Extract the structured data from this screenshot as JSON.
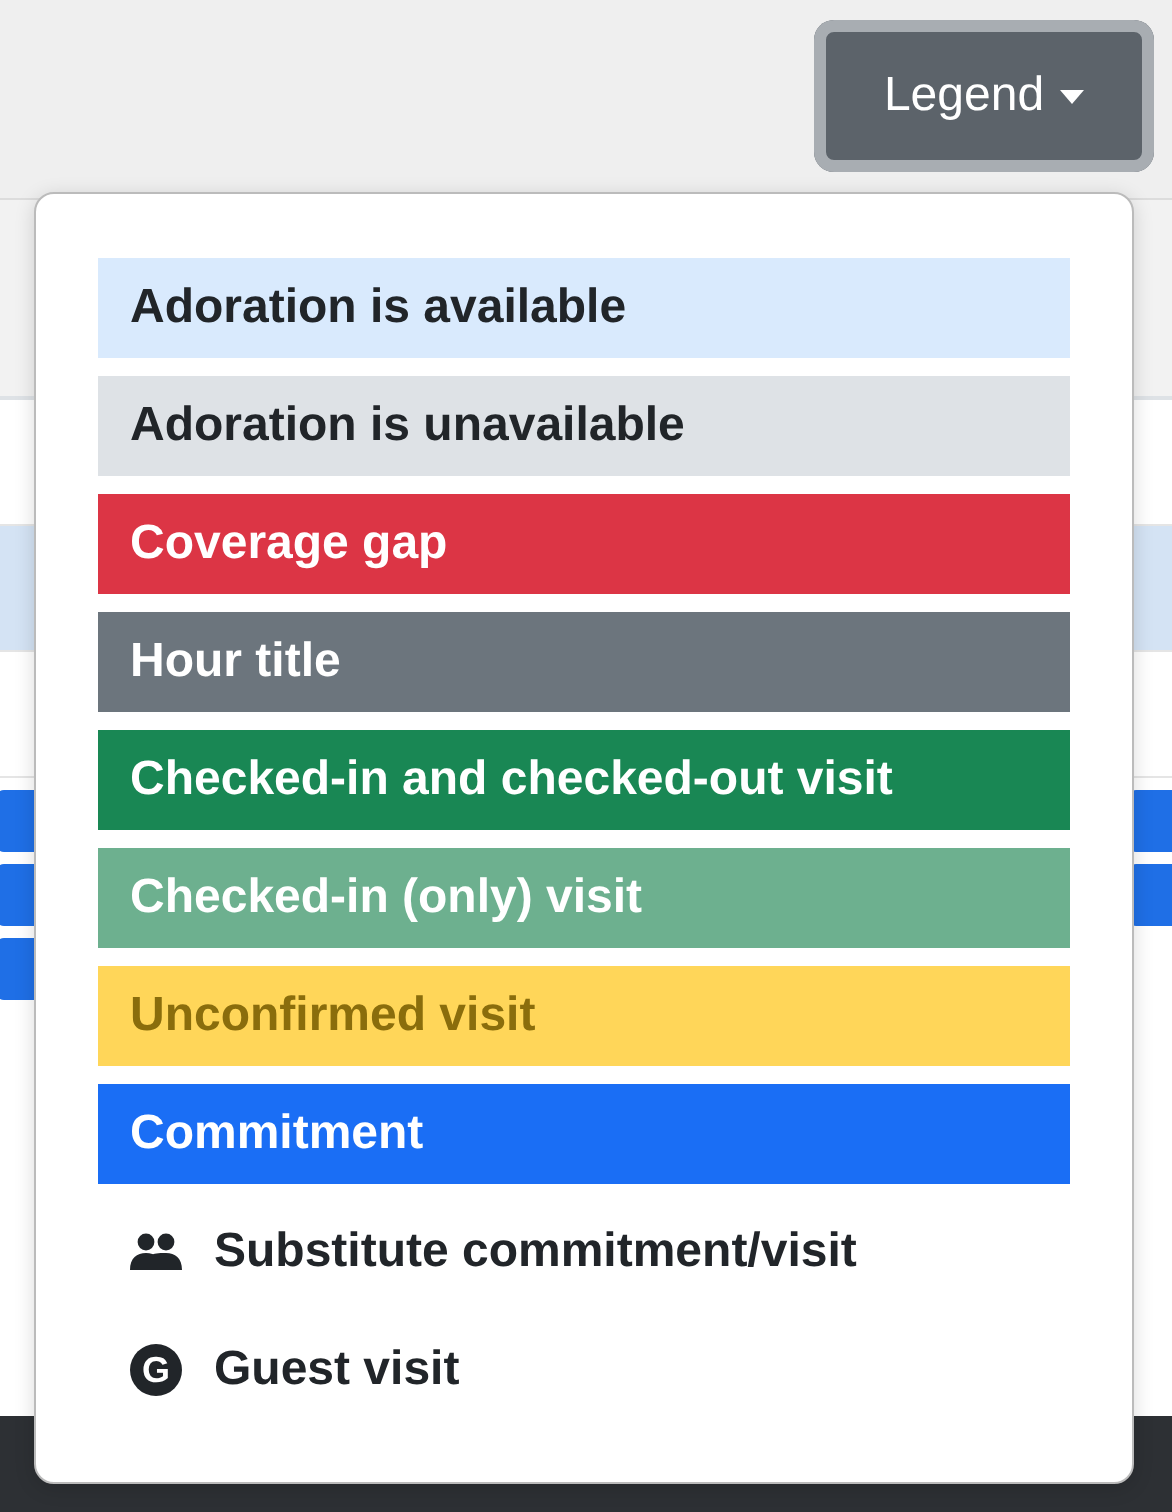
{
  "legend_button": {
    "label": "Legend",
    "expanded": true
  },
  "legend": [
    {
      "kind": "swatch",
      "label": "Adoration is available",
      "color": "#d9eafd"
    },
    {
      "kind": "swatch",
      "label": "Adoration is unavailable",
      "color": "#dee2e6"
    },
    {
      "kind": "swatch",
      "label": "Coverage gap",
      "color": "#dc3545"
    },
    {
      "kind": "swatch",
      "label": "Hour title",
      "color": "#6c757d"
    },
    {
      "kind": "swatch",
      "label": "Checked-in and checked-out visit",
      "color": "#198754"
    },
    {
      "kind": "swatch",
      "label": "Checked-in (only) visit",
      "color": "#6db08f"
    },
    {
      "kind": "swatch",
      "label": "Unconfirmed visit",
      "color": "#ffd659"
    },
    {
      "kind": "swatch",
      "label": "Commitment",
      "color": "#1a6ef5"
    },
    {
      "kind": "people",
      "label": "Substitute commitment/visit"
    },
    {
      "kind": "badge",
      "badge": "G",
      "label": "Guest visit"
    }
  ]
}
